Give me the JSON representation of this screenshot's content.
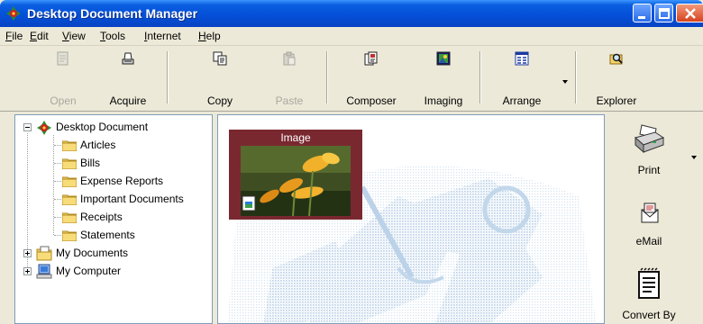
{
  "window": {
    "title": "Desktop Document Manager"
  },
  "menu": [
    "File",
    "Edit",
    "View",
    "Tools",
    "Internet",
    "Help"
  ],
  "toolbar": {
    "buttons": [
      {
        "label": "Open",
        "icon": "open-icon",
        "enabled": false
      },
      {
        "label": "Acquire",
        "icon": "scanner-icon",
        "enabled": true
      },
      {
        "label": "Copy",
        "icon": "copy-icon",
        "enabled": true
      },
      {
        "label": "Paste",
        "icon": "paste-icon",
        "enabled": false
      },
      {
        "label": "Composer",
        "icon": "composer-icon",
        "enabled": true
      },
      {
        "label": "Imaging",
        "icon": "imaging-icon",
        "enabled": true
      },
      {
        "label": "Arrange",
        "icon": "arrange-icon",
        "enabled": true
      },
      {
        "label": "Explorer",
        "icon": "explorer-icon",
        "enabled": true
      }
    ]
  },
  "tree": {
    "root": "Desktop Document",
    "folders": [
      "Articles",
      "Bills",
      "Expense Reports",
      "Important Documents",
      "Receipts",
      "Statements"
    ],
    "other": [
      "My Documents",
      "My Computer"
    ]
  },
  "main": {
    "thumbnail": {
      "label": "Image"
    }
  },
  "rightpane": {
    "items": [
      {
        "label": "Print",
        "icon": "printer-icon"
      },
      {
        "label": "eMail",
        "icon": "email-icon"
      },
      {
        "label": "Convert By",
        "icon": "convert-icon"
      }
    ]
  },
  "colors": {
    "titlebar": "#0550d8",
    "thumb_frame": "#7a2830",
    "watermark": "#c9dbec"
  }
}
